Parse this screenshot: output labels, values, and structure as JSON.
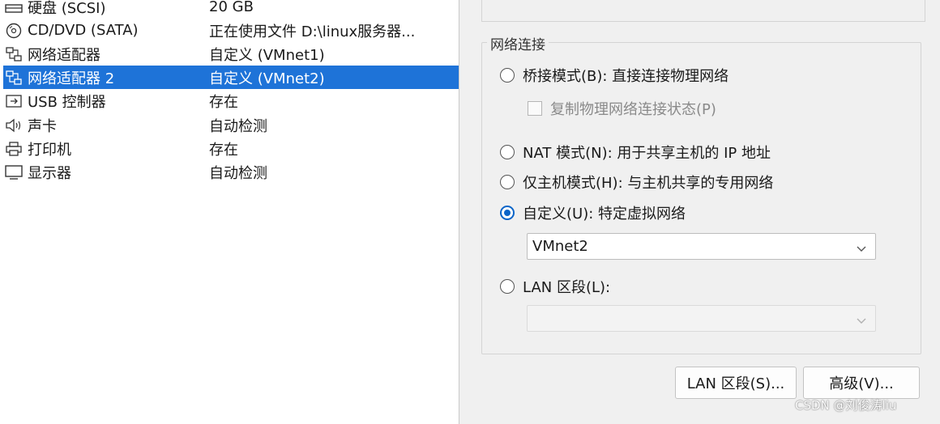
{
  "devices": [
    {
      "name": "硬盘 (SCSI)",
      "summary": "20 GB",
      "icon": "hard-disk-icon",
      "selected": false
    },
    {
      "name": "CD/DVD (SATA)",
      "summary": "正在使用文件 D:\\linux服务器...",
      "icon": "cd-dvd-icon",
      "selected": false
    },
    {
      "name": "网络适配器",
      "summary": "自定义 (VMnet1)",
      "icon": "network-adapter-icon",
      "selected": false
    },
    {
      "name": "网络适配器 2",
      "summary": "自定义 (VMnet2)",
      "icon": "network-adapter-icon",
      "selected": true
    },
    {
      "name": "USB 控制器",
      "summary": "存在",
      "icon": "usb-icon",
      "selected": false
    },
    {
      "name": "声卡",
      "summary": "自动检测",
      "icon": "speaker-icon",
      "selected": false
    },
    {
      "name": "打印机",
      "summary": "存在",
      "icon": "printer-icon",
      "selected": false
    },
    {
      "name": "显示器",
      "summary": "自动检测",
      "icon": "monitor-icon",
      "selected": false
    }
  ],
  "network": {
    "group_title": "网络连接",
    "bridged": {
      "label": "桥接模式(B): 直接连接物理网络",
      "selected": false
    },
    "replicate": {
      "label": "复制物理网络连接状态(P)",
      "checked": false,
      "enabled": false
    },
    "nat": {
      "label": "NAT 模式(N): 用于共享主机的 IP 地址",
      "selected": false
    },
    "hostonly": {
      "label": "仅主机模式(H): 与主机共享的专用网络",
      "selected": false
    },
    "custom": {
      "label": "自定义(U): 特定虚拟网络",
      "selected": true
    },
    "custom_value": "VMnet2",
    "lan": {
      "label": "LAN 区段(L):",
      "selected": false
    },
    "lan_value": ""
  },
  "buttons": {
    "lan_segments": "LAN 区段(S)...",
    "advanced": "高级(V)..."
  },
  "watermark": "CSDN @刘俊涛liu",
  "colors": {
    "selection": "#1e73d8",
    "radio_accent": "#0a64c8"
  }
}
